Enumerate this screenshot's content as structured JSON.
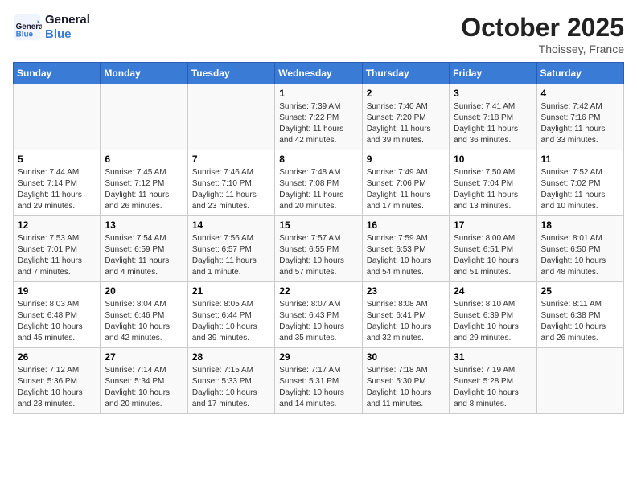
{
  "header": {
    "logo_line1": "General",
    "logo_line2": "Blue",
    "month_title": "October 2025",
    "location": "Thoissey, France"
  },
  "days_of_week": [
    "Sunday",
    "Monday",
    "Tuesday",
    "Wednesday",
    "Thursday",
    "Friday",
    "Saturday"
  ],
  "weeks": [
    [
      {
        "day": "",
        "info": ""
      },
      {
        "day": "",
        "info": ""
      },
      {
        "day": "",
        "info": ""
      },
      {
        "day": "1",
        "info": "Sunrise: 7:39 AM\nSunset: 7:22 PM\nDaylight: 11 hours and 42 minutes."
      },
      {
        "day": "2",
        "info": "Sunrise: 7:40 AM\nSunset: 7:20 PM\nDaylight: 11 hours and 39 minutes."
      },
      {
        "day": "3",
        "info": "Sunrise: 7:41 AM\nSunset: 7:18 PM\nDaylight: 11 hours and 36 minutes."
      },
      {
        "day": "4",
        "info": "Sunrise: 7:42 AM\nSunset: 7:16 PM\nDaylight: 11 hours and 33 minutes."
      }
    ],
    [
      {
        "day": "5",
        "info": "Sunrise: 7:44 AM\nSunset: 7:14 PM\nDaylight: 11 hours and 29 minutes."
      },
      {
        "day": "6",
        "info": "Sunrise: 7:45 AM\nSunset: 7:12 PM\nDaylight: 11 hours and 26 minutes."
      },
      {
        "day": "7",
        "info": "Sunrise: 7:46 AM\nSunset: 7:10 PM\nDaylight: 11 hours and 23 minutes."
      },
      {
        "day": "8",
        "info": "Sunrise: 7:48 AM\nSunset: 7:08 PM\nDaylight: 11 hours and 20 minutes."
      },
      {
        "day": "9",
        "info": "Sunrise: 7:49 AM\nSunset: 7:06 PM\nDaylight: 11 hours and 17 minutes."
      },
      {
        "day": "10",
        "info": "Sunrise: 7:50 AM\nSunset: 7:04 PM\nDaylight: 11 hours and 13 minutes."
      },
      {
        "day": "11",
        "info": "Sunrise: 7:52 AM\nSunset: 7:02 PM\nDaylight: 11 hours and 10 minutes."
      }
    ],
    [
      {
        "day": "12",
        "info": "Sunrise: 7:53 AM\nSunset: 7:01 PM\nDaylight: 11 hours and 7 minutes."
      },
      {
        "day": "13",
        "info": "Sunrise: 7:54 AM\nSunset: 6:59 PM\nDaylight: 11 hours and 4 minutes."
      },
      {
        "day": "14",
        "info": "Sunrise: 7:56 AM\nSunset: 6:57 PM\nDaylight: 11 hours and 1 minute."
      },
      {
        "day": "15",
        "info": "Sunrise: 7:57 AM\nSunset: 6:55 PM\nDaylight: 10 hours and 57 minutes."
      },
      {
        "day": "16",
        "info": "Sunrise: 7:59 AM\nSunset: 6:53 PM\nDaylight: 10 hours and 54 minutes."
      },
      {
        "day": "17",
        "info": "Sunrise: 8:00 AM\nSunset: 6:51 PM\nDaylight: 10 hours and 51 minutes."
      },
      {
        "day": "18",
        "info": "Sunrise: 8:01 AM\nSunset: 6:50 PM\nDaylight: 10 hours and 48 minutes."
      }
    ],
    [
      {
        "day": "19",
        "info": "Sunrise: 8:03 AM\nSunset: 6:48 PM\nDaylight: 10 hours and 45 minutes."
      },
      {
        "day": "20",
        "info": "Sunrise: 8:04 AM\nSunset: 6:46 PM\nDaylight: 10 hours and 42 minutes."
      },
      {
        "day": "21",
        "info": "Sunrise: 8:05 AM\nSunset: 6:44 PM\nDaylight: 10 hours and 39 minutes."
      },
      {
        "day": "22",
        "info": "Sunrise: 8:07 AM\nSunset: 6:43 PM\nDaylight: 10 hours and 35 minutes."
      },
      {
        "day": "23",
        "info": "Sunrise: 8:08 AM\nSunset: 6:41 PM\nDaylight: 10 hours and 32 minutes."
      },
      {
        "day": "24",
        "info": "Sunrise: 8:10 AM\nSunset: 6:39 PM\nDaylight: 10 hours and 29 minutes."
      },
      {
        "day": "25",
        "info": "Sunrise: 8:11 AM\nSunset: 6:38 PM\nDaylight: 10 hours and 26 minutes."
      }
    ],
    [
      {
        "day": "26",
        "info": "Sunrise: 7:12 AM\nSunset: 5:36 PM\nDaylight: 10 hours and 23 minutes."
      },
      {
        "day": "27",
        "info": "Sunrise: 7:14 AM\nSunset: 5:34 PM\nDaylight: 10 hours and 20 minutes."
      },
      {
        "day": "28",
        "info": "Sunrise: 7:15 AM\nSunset: 5:33 PM\nDaylight: 10 hours and 17 minutes."
      },
      {
        "day": "29",
        "info": "Sunrise: 7:17 AM\nSunset: 5:31 PM\nDaylight: 10 hours and 14 minutes."
      },
      {
        "day": "30",
        "info": "Sunrise: 7:18 AM\nSunset: 5:30 PM\nDaylight: 10 hours and 11 minutes."
      },
      {
        "day": "31",
        "info": "Sunrise: 7:19 AM\nSunset: 5:28 PM\nDaylight: 10 hours and 8 minutes."
      },
      {
        "day": "",
        "info": ""
      }
    ]
  ]
}
